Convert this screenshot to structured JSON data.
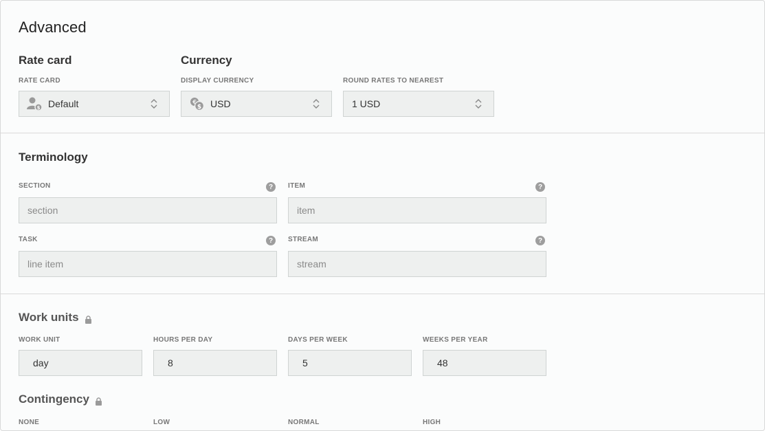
{
  "page": {
    "title": "Advanced"
  },
  "rate_card": {
    "heading": "Rate card",
    "label": "RATE CARD",
    "value": "Default"
  },
  "currency": {
    "heading": "Currency",
    "display_label": "DISPLAY CURRENCY",
    "display_value": "USD",
    "round_label": "ROUND RATES TO NEAREST",
    "round_value": "1 USD"
  },
  "terminology": {
    "heading": "Terminology",
    "section_label": "SECTION",
    "section_placeholder": "section",
    "item_label": "ITEM",
    "item_placeholder": "item",
    "task_label": "TASK",
    "task_placeholder": "line item",
    "stream_label": "STREAM",
    "stream_placeholder": "stream",
    "help_glyph": "?"
  },
  "work_units": {
    "heading": "Work units",
    "work_unit_label": "WORK UNIT",
    "work_unit_value": "day",
    "hours_label": "HOURS PER DAY",
    "hours_value": "8",
    "days_label": "DAYS PER WEEK",
    "days_value": "5",
    "weeks_label": "WEEKS PER YEAR",
    "weeks_value": "48"
  },
  "contingency": {
    "heading": "Contingency",
    "none_label": "NONE",
    "low_label": "LOW",
    "normal_label": "NORMAL",
    "high_label": "HIGH"
  },
  "icons": {
    "user_rate": "user-dollar-icon",
    "currency": "coins-icon",
    "chevron": "chevron-up-down-icon",
    "lock": "lock-icon",
    "help": "help-icon"
  },
  "colors": {
    "field_bg": "#eef0ef",
    "field_border": "#cfd3d2",
    "label": "#777777",
    "help": "#9e9e9e"
  }
}
